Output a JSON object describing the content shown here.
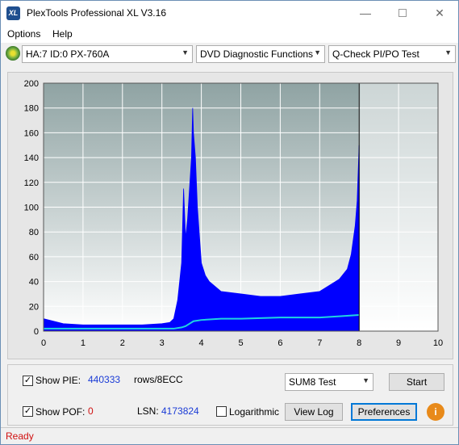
{
  "window": {
    "title": "PlexTools Professional XL V3.16",
    "icon_text": "XL"
  },
  "menu": {
    "items": [
      {
        "label": "Options"
      },
      {
        "label": "Help"
      }
    ]
  },
  "toolbar": {
    "drive": "HA:7 ID:0  PX-760A",
    "function": "DVD Diagnostic Functions",
    "test": "Q-Check PI/PO Test"
  },
  "chart_data": {
    "type": "area",
    "xlim": [
      0,
      10
    ],
    "ylim": [
      0,
      200
    ],
    "x_ticks": [
      0,
      1,
      2,
      3,
      4,
      5,
      6,
      7,
      8,
      9,
      10
    ],
    "y_ticks": [
      0,
      20,
      40,
      60,
      80,
      100,
      120,
      140,
      160,
      180,
      200
    ],
    "end_marker_x": 8.0,
    "colors": {
      "pie": "#0000ff",
      "sum8": "#1fd3e0",
      "background_top": "#8fa3a3",
      "background_bottom": "#ffffff"
    },
    "series": [
      {
        "color": "#0000ff",
        "x": [
          0.0,
          0.5,
          1.0,
          1.5,
          2.0,
          2.5,
          3.0,
          3.2,
          3.3,
          3.4,
          3.5,
          3.55,
          3.6,
          3.65,
          3.7,
          3.75,
          3.78,
          3.8,
          3.85,
          3.9,
          4.0,
          4.1,
          4.2,
          4.5,
          5.0,
          5.5,
          6.0,
          6.5,
          7.0,
          7.3,
          7.5,
          7.7,
          7.8,
          7.9,
          7.95,
          8.0
        ],
        "y": [
          10,
          6,
          5,
          5,
          5,
          5,
          6,
          7,
          10,
          25,
          55,
          115,
          75,
          90,
          115,
          140,
          180,
          160,
          140,
          100,
          55,
          45,
          40,
          32,
          30,
          28,
          28,
          30,
          32,
          38,
          42,
          50,
          62,
          85,
          105,
          150
        ]
      },
      {
        "color": "#1fd3e0",
        "x": [
          0.0,
          1.0,
          2.0,
          3.0,
          3.3,
          3.5,
          3.6,
          3.7,
          3.8,
          4.0,
          4.5,
          5.0,
          6.0,
          7.0,
          7.5,
          8.0
        ],
        "y": [
          2,
          2,
          2,
          2,
          2,
          3,
          4,
          6,
          8,
          9,
          10,
          10,
          11,
          11,
          12,
          13
        ]
      }
    ]
  },
  "panel": {
    "show_pie_label": "Show PIE:",
    "pie_value": "440333",
    "pie_unit": "rows/8ECC",
    "show_pof_label": "Show POF:",
    "pof_value": "0",
    "lsn_label": "LSN:",
    "lsn_value": "4173824",
    "logarithmic_label": "Logarithmic",
    "test_select": "SUM8 Test",
    "start_label": "Start",
    "view_log_label": "View Log",
    "preferences_label": "Preferences",
    "info_label": "i"
  },
  "status": {
    "text": "Ready"
  }
}
